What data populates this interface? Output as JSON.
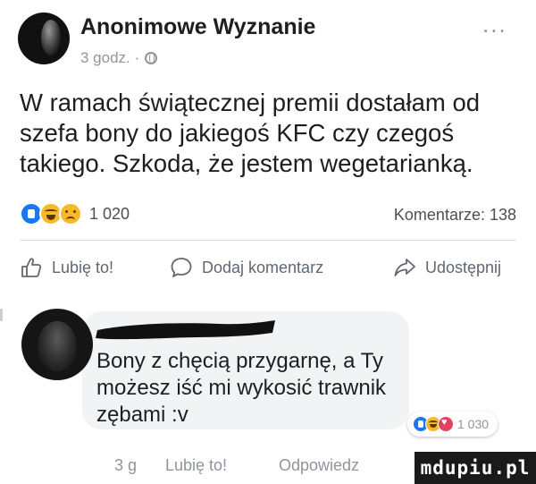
{
  "post": {
    "author": "Anonimowe Wyznanie",
    "time": "3 godz. ·",
    "privacy_icon": "globe-icon",
    "more_icon": "...",
    "text": "W ramach świątecznej premii dostałam od szefa bony do jakiegoś KFC czy czegoś takiego. Szkoda, że jestem wegetarianką.",
    "reactions": {
      "icons": [
        "like",
        "haha",
        "sad"
      ],
      "count": "1 020"
    },
    "comments_count": "Komentarze: 138"
  },
  "actions": {
    "like_label": "Lubię to!",
    "comment_label": "Dodaj komentarz",
    "share_label": "Udostępnij"
  },
  "comment": {
    "text": "Bony z chęcią przygarnę, a Ty możesz iść mi wykosić trawnik zębami :v",
    "reactions": {
      "icons": [
        "like",
        "haha",
        "love"
      ],
      "count": "1 030"
    },
    "time": "3 g",
    "like_label": "Lubię to!",
    "reply_label": "Odpowiedz"
  },
  "watermark": "mdupiu.pl",
  "colors": {
    "accent": "#1877f2",
    "muted": "#90949c",
    "bubble": "#f2f3f5"
  }
}
